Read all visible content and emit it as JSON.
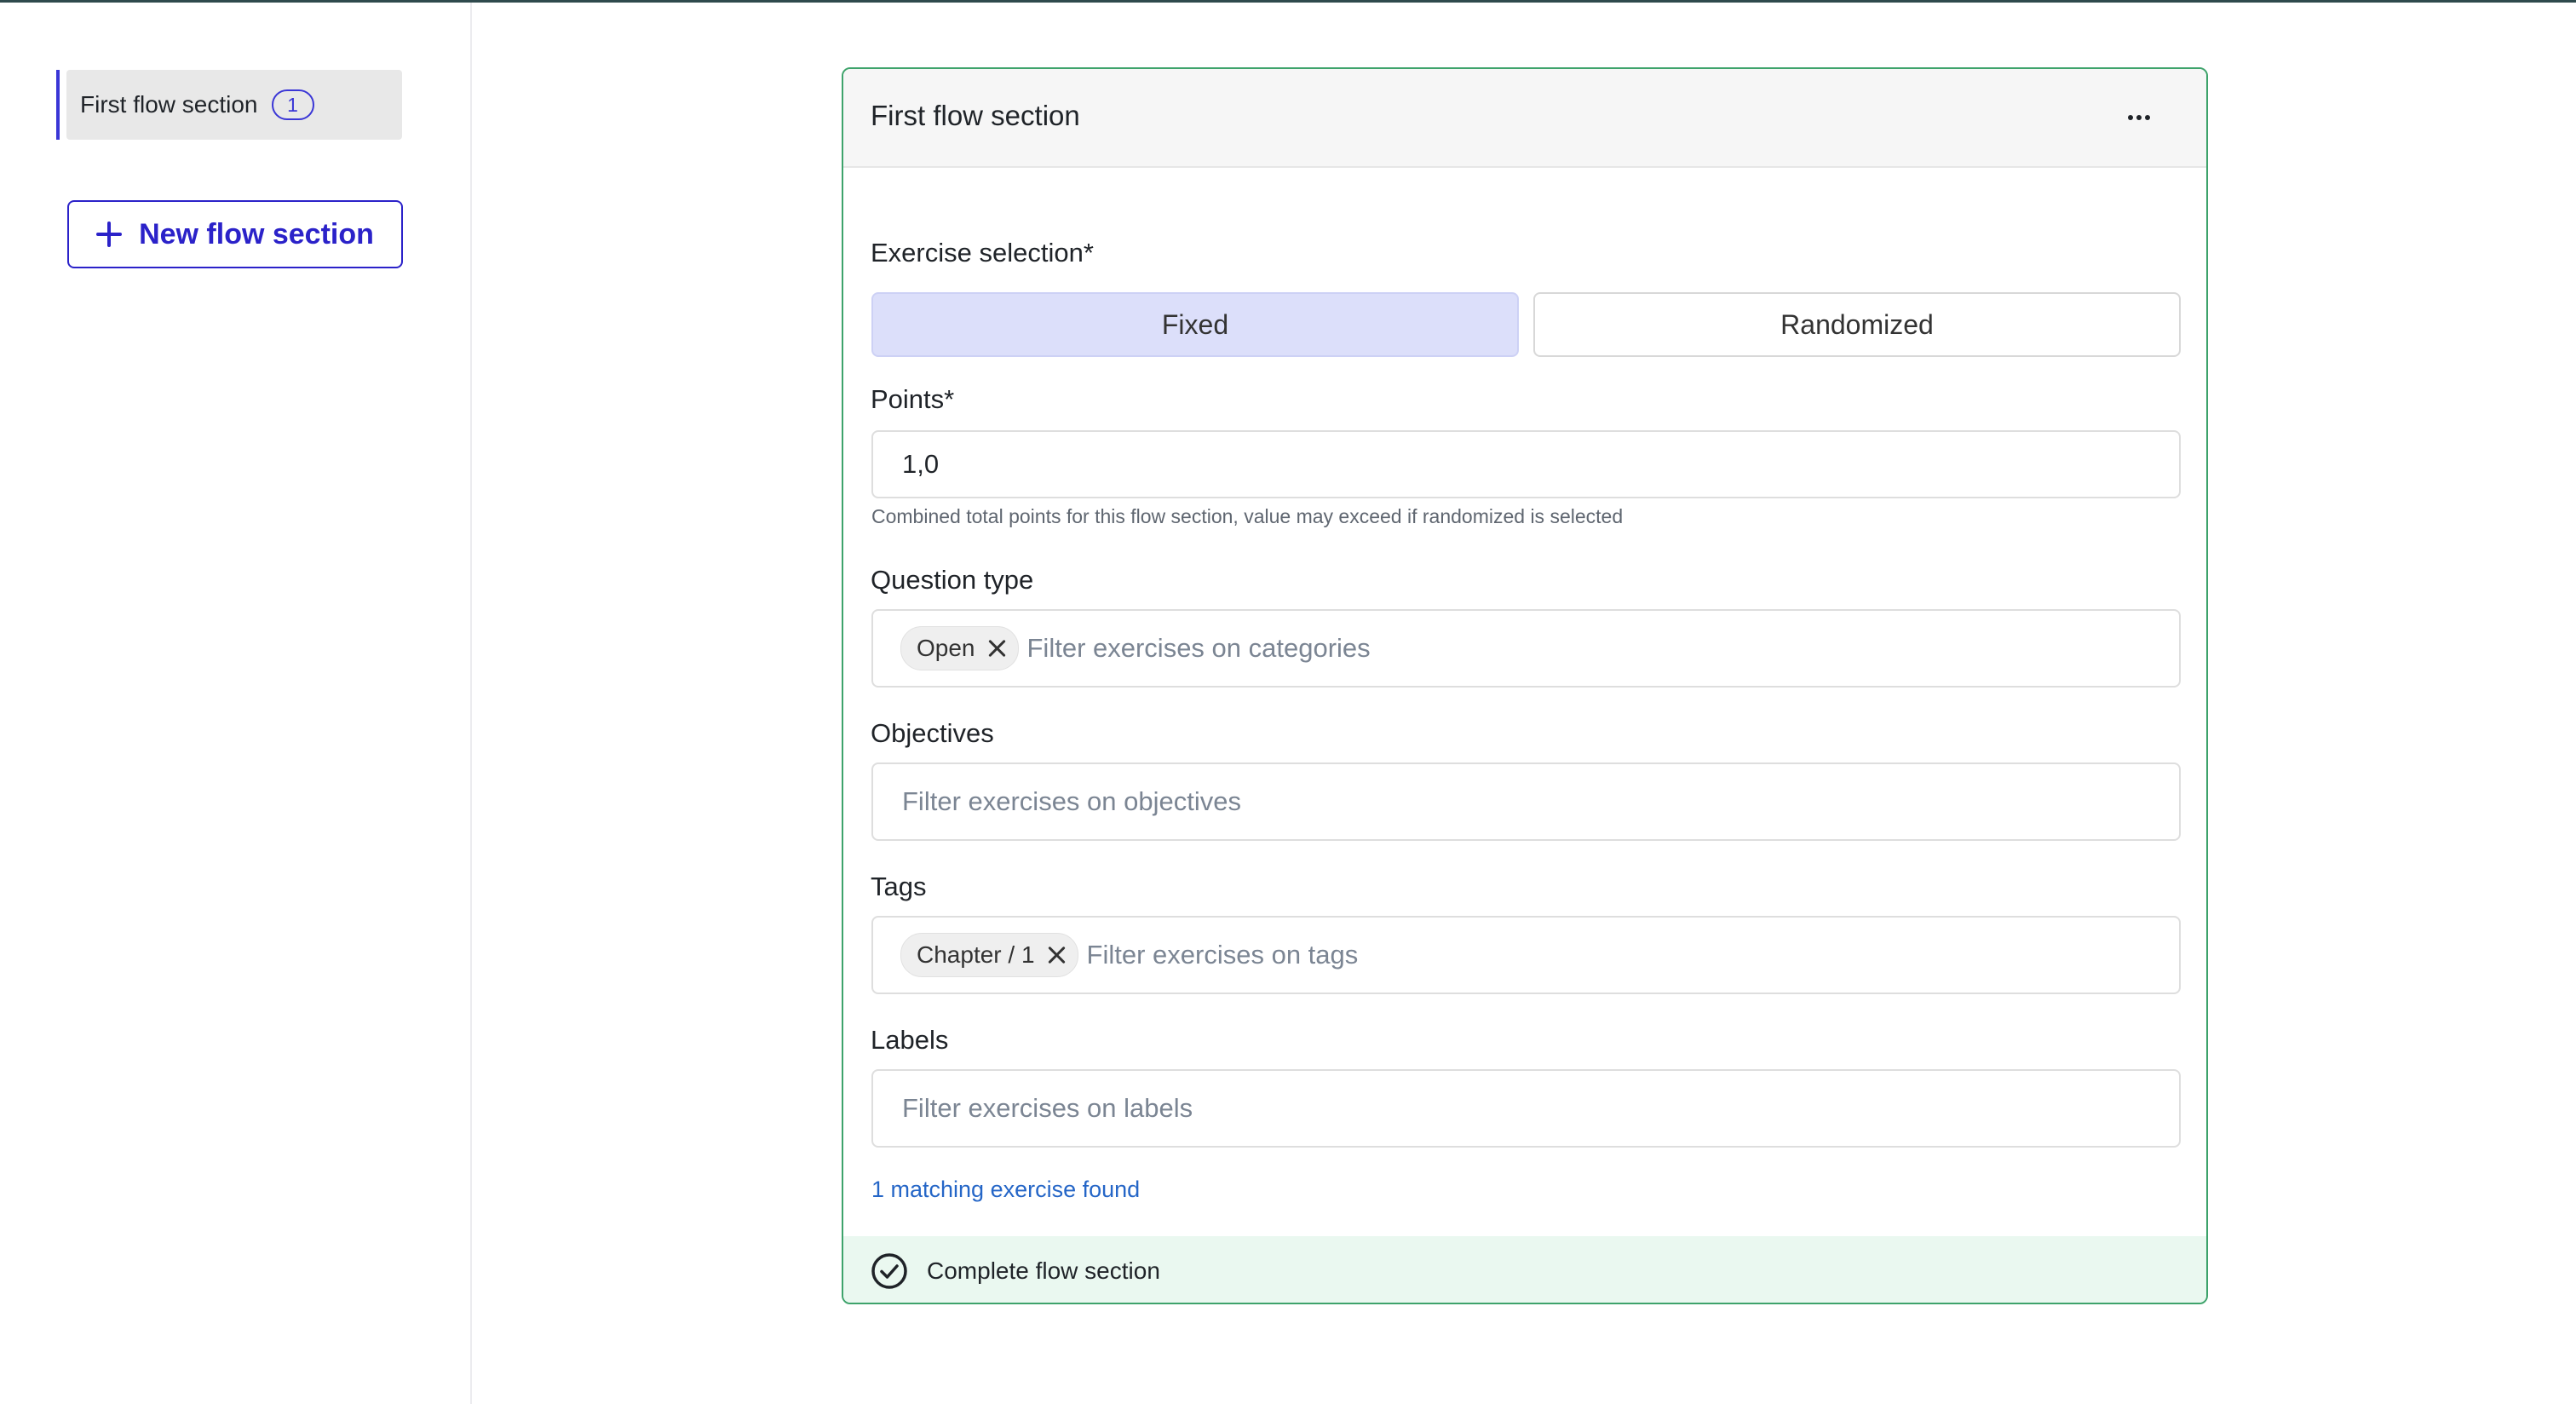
{
  "sidebar": {
    "items": [
      {
        "label": "First flow section",
        "count": "1"
      }
    ],
    "new_section_label": "New flow section"
  },
  "section": {
    "title": "First flow section",
    "exercise_selection": {
      "label": "Exercise selection*",
      "options": [
        "Fixed",
        "Randomized"
      ],
      "selected": "Fixed"
    },
    "points": {
      "label": "Points*",
      "value": "1,0",
      "helper": "Combined total points for this flow section, value may exceed if randomized is selected"
    },
    "question_type": {
      "label": "Question type",
      "chips": [
        "Open"
      ],
      "placeholder": "Filter exercises on categories"
    },
    "objectives": {
      "label": "Objectives",
      "placeholder": "Filter exercises on objectives"
    },
    "tags": {
      "label": "Tags",
      "chips": [
        "Chapter / 1"
      ],
      "placeholder": "Filter exercises on tags"
    },
    "labels": {
      "label": "Labels",
      "placeholder": "Filter exercises on labels"
    },
    "matching_text": "1 matching exercise found",
    "complete_label": "Complete flow section"
  },
  "colors": {
    "accent": "#2b22c9",
    "selected_segment": "#dcdffa",
    "card_border": "#3ea36b",
    "footer_bg": "#eaf8f0",
    "link": "#2566c7"
  },
  "icons": [
    "plus-icon",
    "more-icon",
    "close-icon",
    "check-circle-icon"
  ]
}
